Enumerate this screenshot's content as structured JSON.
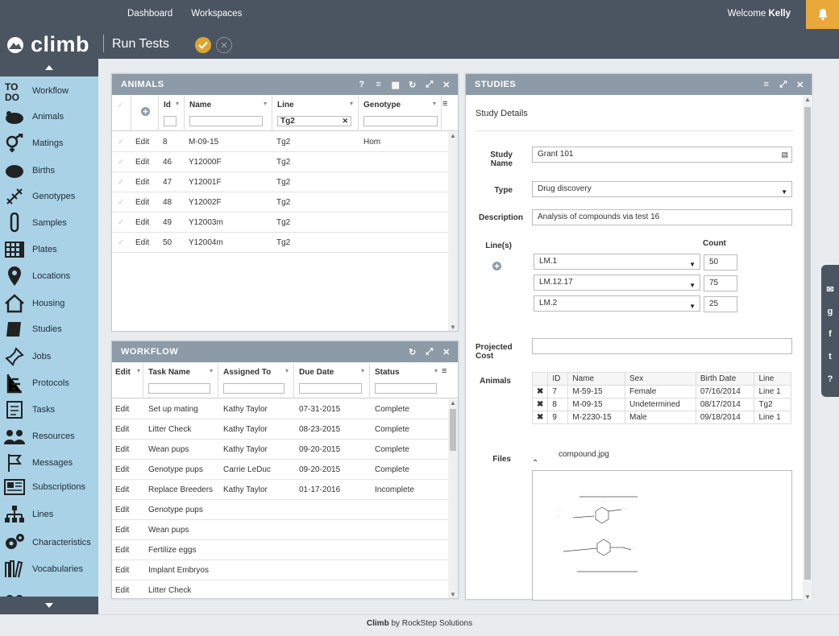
{
  "topnav": {
    "dashboard": "Dashboard",
    "workspaces": "Workspaces",
    "welcome": "Welcome",
    "user": "Kelly"
  },
  "app": {
    "logo": "climb",
    "page_title": "Run Tests"
  },
  "sidebar": {
    "items": [
      {
        "label": "Workflow",
        "icon": "todo-icon"
      },
      {
        "label": "Animals",
        "icon": "mouse-icon"
      },
      {
        "label": "Matings",
        "icon": "gender-icon"
      },
      {
        "label": "Births",
        "icon": "mouse-pups-icon"
      },
      {
        "label": "Genotypes",
        "icon": "dna-icon"
      },
      {
        "label": "Samples",
        "icon": "test-tube-icon"
      },
      {
        "label": "Plates",
        "icon": "plate-icon"
      },
      {
        "label": "Locations",
        "icon": "map-pin-icon"
      },
      {
        "label": "Housing",
        "icon": "house-icon"
      },
      {
        "label": "Studies",
        "icon": "book-icon"
      },
      {
        "label": "Jobs",
        "icon": "pin-icon"
      },
      {
        "label": "Protocols",
        "icon": "list-icon"
      },
      {
        "label": "Tasks",
        "icon": "checklist-icon"
      },
      {
        "label": "Resources",
        "icon": "people-icon"
      },
      {
        "label": "Messages",
        "icon": "flag-icon"
      },
      {
        "label": "Subscriptions",
        "icon": "newspaper-icon"
      },
      {
        "label": "Lines",
        "icon": "hierarchy-icon"
      },
      {
        "label": "Characteristics",
        "icon": "gears-icon"
      },
      {
        "label": "Vocabularies",
        "icon": "books-icon"
      }
    ]
  },
  "animals": {
    "title": "ANIMALS",
    "columns": [
      "Id",
      "Name",
      "Line",
      "Genotype"
    ],
    "line_filter": "Tg2",
    "rows": [
      {
        "edit": "Edit",
        "id": "8",
        "name": "M-09-15",
        "line": "Tg2",
        "genotype": "Hom"
      },
      {
        "edit": "Edit",
        "id": "46",
        "name": "Y12000F",
        "line": "Tg2",
        "genotype": ""
      },
      {
        "edit": "Edit",
        "id": "47",
        "name": "Y12001F",
        "line": "Tg2",
        "genotype": ""
      },
      {
        "edit": "Edit",
        "id": "48",
        "name": "Y12002F",
        "line": "Tg2",
        "genotype": ""
      },
      {
        "edit": "Edit",
        "id": "49",
        "name": "Y12003m",
        "line": "Tg2",
        "genotype": ""
      },
      {
        "edit": "Edit",
        "id": "50",
        "name": "Y12004m",
        "line": "Tg2",
        "genotype": ""
      }
    ]
  },
  "workflow": {
    "title": "WORKFLOW",
    "columns": [
      "Edit",
      "Task Name",
      "Assigned To",
      "Due Date",
      "Status"
    ],
    "rows": [
      {
        "edit": "Edit",
        "task": "Set up mating",
        "assigned": "Kathy Taylor",
        "due": "07-31-2015",
        "status": "Complete"
      },
      {
        "edit": "Edit",
        "task": "Litter Check",
        "assigned": "Kathy Taylor",
        "due": "08-23-2015",
        "status": "Complete"
      },
      {
        "edit": "Edit",
        "task": "Wean pups",
        "assigned": "Kathy Taylor",
        "due": "09-20-2015",
        "status": "Complete"
      },
      {
        "edit": "Edit",
        "task": "Genotype pups",
        "assigned": "Carrie LeDuc",
        "due": "09-20-2015",
        "status": "Complete"
      },
      {
        "edit": "Edit",
        "task": "Replace Breeders",
        "assigned": "Kathy Taylor",
        "due": "01-17-2016",
        "status": "Incomplete"
      },
      {
        "edit": "Edit",
        "task": "Genotype pups",
        "assigned": "",
        "due": "",
        "status": ""
      },
      {
        "edit": "Edit",
        "task": "Wean pups",
        "assigned": "",
        "due": "",
        "status": ""
      },
      {
        "edit": "Edit",
        "task": "Fertilize eggs",
        "assigned": "",
        "due": "",
        "status": ""
      },
      {
        "edit": "Edit",
        "task": "Implant Embryos",
        "assigned": "",
        "due": "",
        "status": ""
      },
      {
        "edit": "Edit",
        "task": "Litter Check",
        "assigned": "",
        "due": "",
        "status": ""
      }
    ]
  },
  "studies": {
    "title": "STUDIES",
    "subtitle": "Study Details",
    "labels": {
      "study_name": "Study Name",
      "type": "Type",
      "description": "Description",
      "lines": "Line(s)",
      "count": "Count",
      "projected_cost": "Projected Cost",
      "animals": "Animals",
      "files": "Files"
    },
    "study_name": "Grant 101",
    "type": "Drug discovery",
    "description": "Analysis of compounds via test 16",
    "projected_cost": "",
    "lines": [
      {
        "line": "LM.1",
        "count": "50"
      },
      {
        "line": "LM.12.17",
        "count": "75"
      },
      {
        "line": "LM.2",
        "count": "25"
      }
    ],
    "animal_columns": [
      "ID",
      "Name",
      "Sex",
      "Birth Date",
      "Line"
    ],
    "animal_rows": [
      {
        "id": "7",
        "name": "M-59-15",
        "sex": "Female",
        "birth": "07/16/2014",
        "line": "Line 1"
      },
      {
        "id": "8",
        "name": "M-09-15",
        "sex": "Undetermined",
        "birth": "08/17/2014",
        "line": "Tg2"
      },
      {
        "id": "9",
        "name": "M-2230-15",
        "sex": "Male",
        "birth": "09/18/2014",
        "line": "Line 1"
      }
    ],
    "file_name": "compound.jpg"
  },
  "footer": {
    "brand": "Climb",
    "by": "by RockStep Solutions"
  },
  "colors": {
    "topbar": "#4b5461",
    "sidebar": "#a9d2e6",
    "panel_header": "#8d9aa7",
    "accent": "#e8a83a"
  }
}
